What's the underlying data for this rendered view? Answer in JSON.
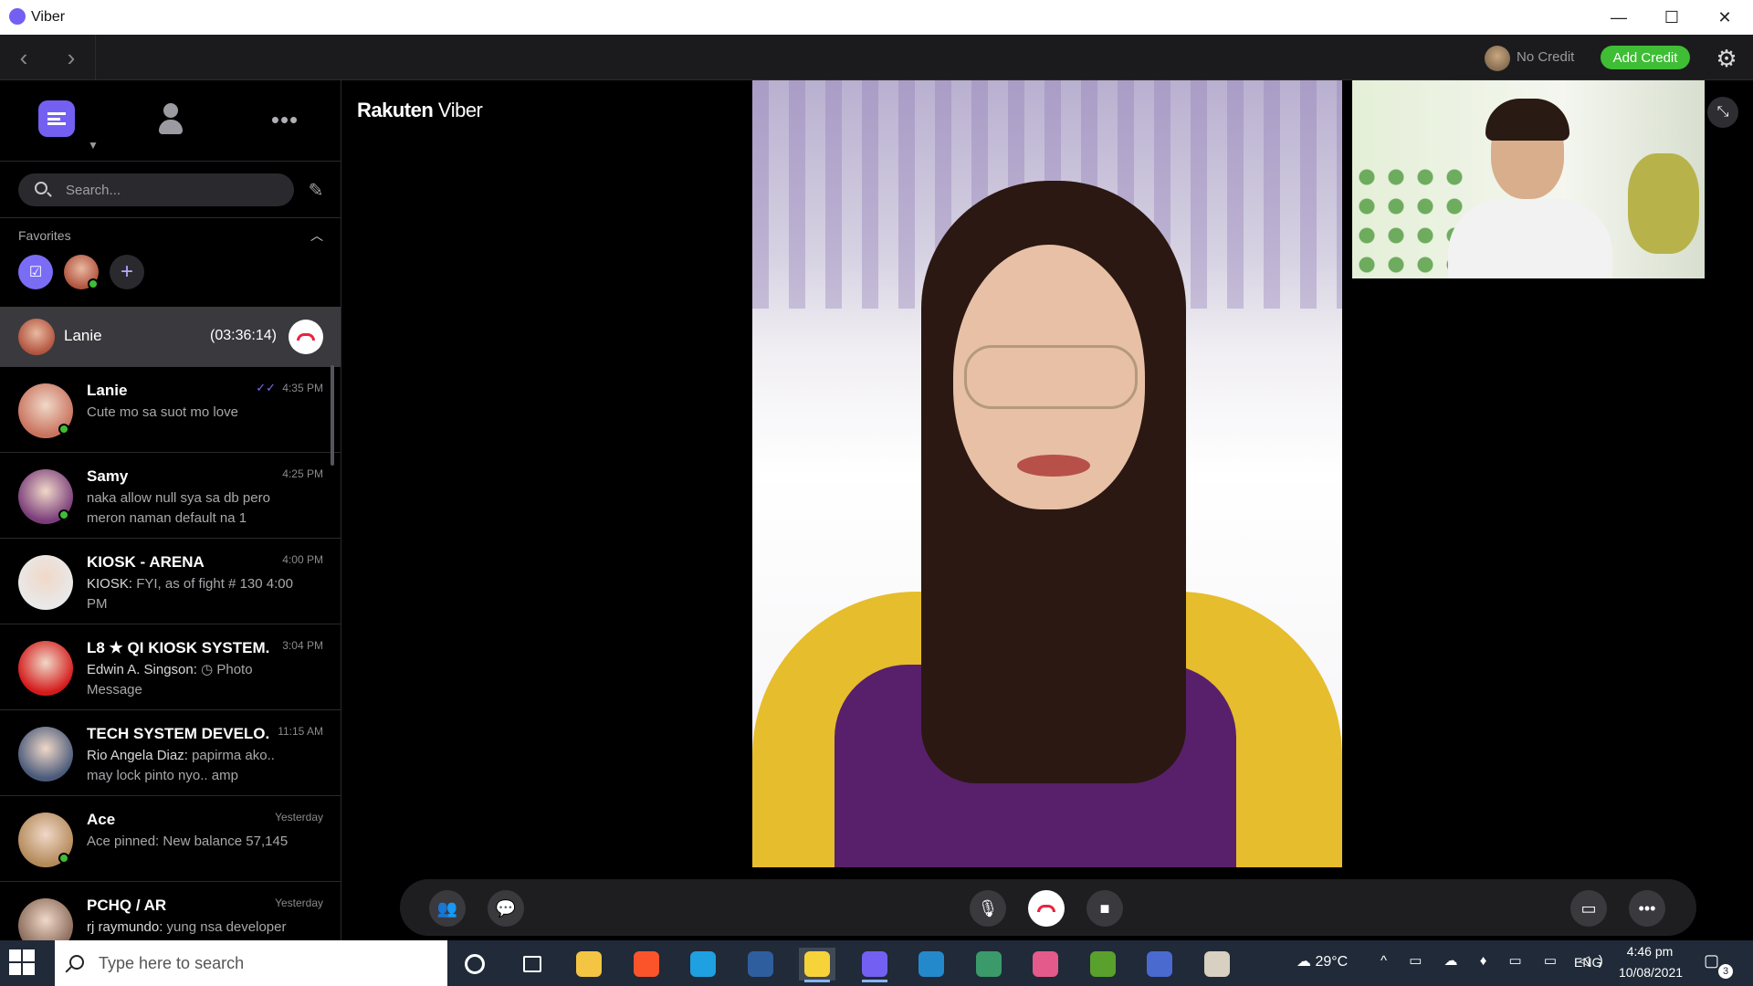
{
  "window": {
    "title": "Viber",
    "minimize": "—",
    "maximize": "☐",
    "close": "✕"
  },
  "toolbar": {
    "back": "‹",
    "forward": "›",
    "no_credit": "No Credit",
    "add_credit": "Add Credit",
    "settings_icon": "gear-icon"
  },
  "sidebar": {
    "tabs": {
      "chats_icon": "chat-bubble-icon",
      "contacts_icon": "person-icon",
      "more": "•••"
    },
    "search": {
      "placeholder": "Search..."
    },
    "favorites": {
      "label": "Favorites",
      "notes_glyph": "☑",
      "add_glyph": "+"
    },
    "active_call": {
      "name": "Lanie",
      "duration": "(03:36:14)"
    },
    "chats": [
      {
        "name": "Lanie",
        "sender": "",
        "message": "Cute mo sa suot mo love",
        "time": "4:35 PM",
        "read": "✓✓",
        "online": true,
        "avatar_color": "#c9735e"
      },
      {
        "name": "Samy",
        "sender": "",
        "message": "naka allow null sya sa db pero meron naman default na 1",
        "time": "4:25 PM",
        "read": "",
        "online": true,
        "avatar_color": "#7a3d7a"
      },
      {
        "name": "KIOSK - ARENA",
        "sender": "KIOSK:",
        "message": " FYI, as of fight # 130 4:00 PM",
        "time": "4:00 PM",
        "read": "",
        "online": false,
        "avatar_color": "#e9e9e9"
      },
      {
        "name": "L8 ★ QI KIOSK SYSTEM...",
        "sender": "Edwin A. Singson:",
        "message": " ◷ Photo Message",
        "time": "3:04 PM",
        "read": "",
        "online": false,
        "avatar_color": "#d41a1a"
      },
      {
        "name": "TECH SYSTEM DEVELO...",
        "sender": "Rio Angela Diaz:",
        "message": " papirma ako.. may lock pinto nyo.. amp",
        "time": "11:15 AM",
        "read": "",
        "online": false,
        "avatar_color": "#4a5a7a"
      },
      {
        "name": "Ace",
        "sender": "",
        "message": "Ace pinned: New balance 57,145",
        "time": "Yesterday",
        "read": "",
        "online": true,
        "avatar_color": "#b48a5a"
      },
      {
        "name": "PCHQ / AR",
        "sender": "rj raymundo:",
        "message": " yung nsa developer",
        "time": "Yesterday",
        "read": "",
        "online": false,
        "avatar_color": "#8a6a5a"
      }
    ]
  },
  "main": {
    "brand_1": "Rakuten",
    "brand_2": "Viber",
    "expand_icon": "⤡"
  },
  "controls": {
    "add_participant_icon": "add-participant-icon",
    "chat_icon": "chat-icon",
    "mic_icon": "microphone-icon",
    "end_call_icon": "end-call-icon",
    "video_icon": "video-camera-icon",
    "screen_share_icon": "screen-share-icon",
    "more": "•••"
  },
  "taskbar": {
    "search_placeholder": "Type here to search",
    "weather": "29°C",
    "tray": "^ ▭ ☁ ♦ ▭ ▭ ◁)",
    "language": "ENG",
    "time": "4:46 pm",
    "date": "10/08/2021",
    "notifications": "3",
    "apps": [
      {
        "name": "cortana",
        "color": "#ffffff"
      },
      {
        "name": "task-view",
        "color": "#ffffff"
      },
      {
        "name": "file-explorer",
        "color": "#f4c542"
      },
      {
        "name": "brave",
        "color": "#fb542b"
      },
      {
        "name": "edge",
        "color": "#1fa0e0"
      },
      {
        "name": "virtualbox",
        "color": "#2f5e9e"
      },
      {
        "name": "sticky-notes",
        "color": "#f7d33a"
      },
      {
        "name": "viber",
        "color": "#7360f2"
      },
      {
        "name": "vscode",
        "color": "#2489ca"
      },
      {
        "name": "sql-tool",
        "color": "#3a9a6a"
      },
      {
        "name": "color-app",
        "color": "#e45a8a"
      },
      {
        "name": "heidisql",
        "color": "#5aa02c"
      },
      {
        "name": "network-tool",
        "color": "#4a6ad0"
      },
      {
        "name": "paint",
        "color": "#d8d0c0"
      }
    ]
  },
  "colors": {
    "viber_purple": "#7360f2",
    "credit_green": "#3ebd35",
    "end_call_red": "#e8243f",
    "online_green": "#3ebd35"
  }
}
